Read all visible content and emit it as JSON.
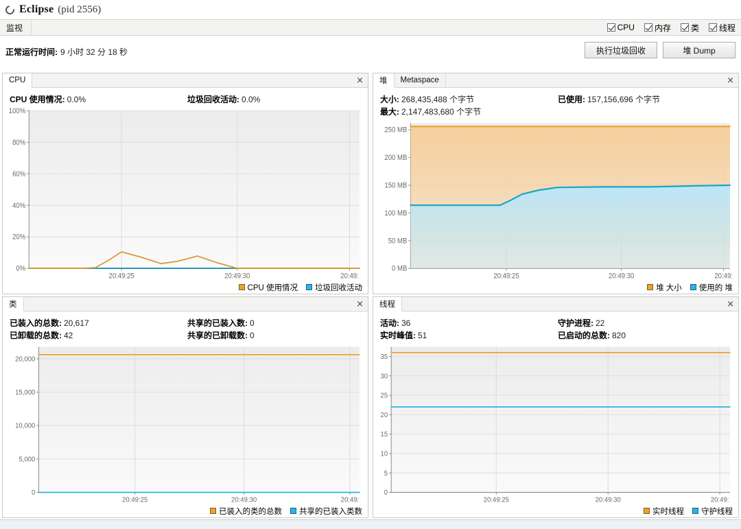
{
  "window": {
    "app_name": "Eclipse",
    "pid_text": "(pid 2556)",
    "process_icon": "process-circle-icon"
  },
  "tabstrip": {
    "tab_label": "监视",
    "checkboxes": [
      {
        "label": "CPU",
        "checked": true
      },
      {
        "label": "内存",
        "checked": true
      },
      {
        "label": "类",
        "checked": true
      },
      {
        "label": "线程",
        "checked": true
      }
    ]
  },
  "uptime": {
    "label": "正常运行时间:",
    "value": "9 小时 32 分 18 秒"
  },
  "toolbar": {
    "gc_button": "执行垃圾回收",
    "heapdump_button": "堆 Dump"
  },
  "panels": {
    "cpu": {
      "title": "CPU",
      "close": "×",
      "stats": [
        {
          "label": "CPU 使用情况:",
          "value": "0.0%"
        },
        {
          "label": "垃圾回收活动:",
          "value": "0.0%"
        }
      ],
      "legend": [
        {
          "label": "CPU 使用情况",
          "color": "#eda12c"
        },
        {
          "label": "垃圾回收活动",
          "color": "#29b6e0"
        }
      ]
    },
    "heap": {
      "tabs": [
        {
          "label": "堆",
          "selected": true
        },
        {
          "label": "Metaspace",
          "selected": false
        }
      ],
      "close": "×",
      "stats": [
        {
          "label": "大小:",
          "value": "268,435,488 个字节"
        },
        {
          "label": "已使用:",
          "value": "157,156,696 个字节"
        },
        {
          "label": "最大:",
          "value": "2,147,483,680 个字节"
        }
      ],
      "legend": [
        {
          "label": "堆 大小",
          "color": "#eda12c"
        },
        {
          "label": "使用的 堆",
          "color": "#29b6e0"
        }
      ]
    },
    "classes": {
      "title": "类",
      "close": "×",
      "stats": [
        {
          "label": "已装入的总数:",
          "value": "20,617"
        },
        {
          "label": "共享的已装入数:",
          "value": "0"
        },
        {
          "label": "已卸载的总数:",
          "value": "42"
        },
        {
          "label": "共享的已卸载数:",
          "value": "0"
        }
      ],
      "legend": [
        {
          "label": "已装入的类的总数",
          "color": "#eda12c"
        },
        {
          "label": "共享的已装入类数",
          "color": "#29b6e0"
        }
      ]
    },
    "threads": {
      "title": "线程",
      "close": "×",
      "stats": [
        {
          "label": "活动:",
          "value": "36"
        },
        {
          "label": "守护进程:",
          "value": "22"
        },
        {
          "label": "实时峰值:",
          "value": "51"
        },
        {
          "label": "已启动的总数:",
          "value": "820"
        }
      ],
      "legend": [
        {
          "label": "实时线程",
          "color": "#eda12c"
        },
        {
          "label": "守护线程",
          "color": "#29b6e0"
        }
      ]
    }
  },
  "chart_data": [
    {
      "id": "cpu",
      "type": "line",
      "title": "CPU",
      "xlabel": "",
      "ylabel": "",
      "ylim": [
        0,
        100
      ],
      "yticks": [
        0,
        20,
        40,
        60,
        80,
        100
      ],
      "ytick_labels": [
        "0%",
        "20%",
        "40%",
        "60%",
        "80%",
        "100%"
      ],
      "xtick_labels": [
        "20:49:25",
        "20:49:30",
        "20:49:"
      ],
      "xtick_positions": [
        0.28,
        0.63,
        0.97
      ],
      "grid": true,
      "legend_position": "bottom-right",
      "series": [
        {
          "name": "CPU 使用情况",
          "color": "#d89a2e",
          "x": [
            0.0,
            0.1,
            0.16,
            0.2,
            0.24,
            0.28,
            0.34,
            0.4,
            0.45,
            0.51,
            0.57,
            0.63,
            1.0
          ],
          "values": [
            0.0,
            0.0,
            0.0,
            0.4,
            5.0,
            10.5,
            7.0,
            3.0,
            4.5,
            7.8,
            3.5,
            0.0,
            0.0
          ]
        },
        {
          "name": "垃圾回收活动",
          "color": "#1f8fb5",
          "x": [
            0.0,
            1.0
          ],
          "values": [
            0.0,
            0.0
          ]
        }
      ]
    },
    {
      "id": "heap",
      "type": "area",
      "title": "堆",
      "xlabel": "",
      "ylabel": "MB",
      "ylim": [
        0,
        262
      ],
      "yticks": [
        0,
        50,
        100,
        150,
        200,
        250
      ],
      "ytick_labels": [
        "0 MB",
        "50 MB",
        "100 MB",
        "150 MB",
        "200 MB",
        "250 MB"
      ],
      "xtick_labels": [
        "20:49:25",
        "20:49:30",
        "20:49:"
      ],
      "xtick_positions": [
        0.3,
        0.66,
        0.98
      ],
      "grid": true,
      "legend_position": "bottom-right",
      "series": [
        {
          "name": "堆 大小",
          "color": "#eda12c",
          "fill": "#f6cf9c",
          "x": [
            0.0,
            1.0
          ],
          "values": [
            256,
            256
          ]
        },
        {
          "name": "使用的 堆",
          "color": "#19a5c6",
          "fill": "#bbe6f7",
          "x": [
            0.0,
            0.18,
            0.28,
            0.31,
            0.35,
            0.4,
            0.46,
            0.6,
            0.75,
            0.9,
            1.0
          ],
          "values": [
            114,
            114,
            114,
            122,
            134,
            141,
            146,
            147,
            147,
            149,
            150
          ]
        }
      ]
    },
    {
      "id": "classes",
      "type": "line",
      "title": "类",
      "xlabel": "",
      "ylabel": "",
      "ylim": [
        0,
        21800
      ],
      "yticks": [
        0,
        5000,
        10000,
        15000,
        20000
      ],
      "ytick_labels": [
        "0",
        "5,000",
        "10,000",
        "15,000",
        "20,000"
      ],
      "xtick_labels": [
        "20:49:25",
        "20:49:30",
        "20:49:"
      ],
      "xtick_positions": [
        0.3,
        0.64,
        0.97
      ],
      "grid": true,
      "legend_position": "bottom-right",
      "series": [
        {
          "name": "已装入的类的总数",
          "color": "#eda12c",
          "x": [
            0.0,
            1.0
          ],
          "values": [
            20617,
            20617
          ]
        },
        {
          "name": "共享的已装入类数",
          "color": "#29b6e0",
          "x": [
            0.0,
            1.0
          ],
          "values": [
            0,
            0
          ]
        }
      ]
    },
    {
      "id": "threads",
      "type": "line",
      "title": "线程",
      "xlabel": "",
      "ylabel": "",
      "ylim": [
        0,
        37.5
      ],
      "yticks": [
        0,
        5,
        10,
        15,
        20,
        25,
        30,
        35
      ],
      "ytick_labels": [
        "0",
        "5",
        "10",
        "15",
        "20",
        "25",
        "30",
        "35"
      ],
      "xtick_labels": [
        "20:49:25",
        "20:49:30",
        "20:49:"
      ],
      "xtick_positions": [
        0.31,
        0.64,
        0.97
      ],
      "grid": true,
      "legend_position": "bottom-right",
      "series": [
        {
          "name": "实时线程",
          "color": "#eda12c",
          "x": [
            0.0,
            1.0
          ],
          "values": [
            36,
            36
          ]
        },
        {
          "name": "守护线程",
          "color": "#29b6e0",
          "x": [
            0.0,
            1.0
          ],
          "values": [
            22,
            22
          ]
        }
      ]
    }
  ]
}
